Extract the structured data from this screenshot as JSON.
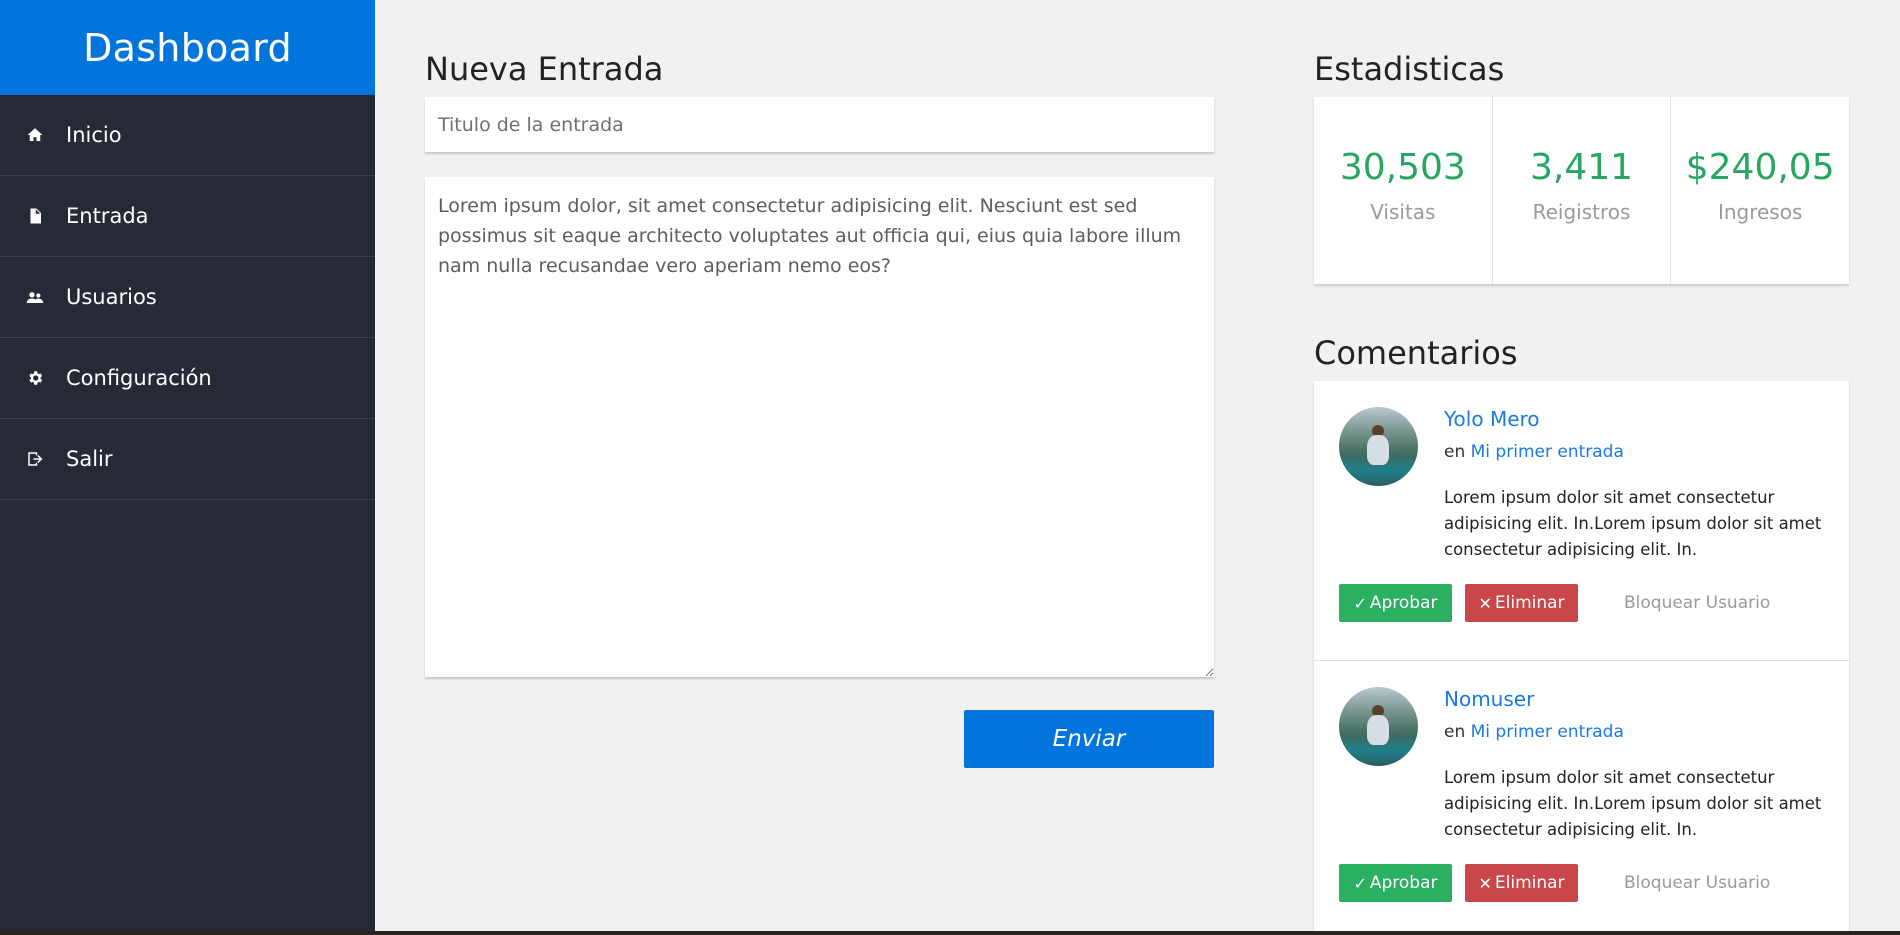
{
  "sidebar": {
    "brand": "Dashboard",
    "items": [
      {
        "label": "Inicio",
        "icon": "home-icon"
      },
      {
        "label": "Entrada",
        "icon": "document-icon"
      },
      {
        "label": "Usuarios",
        "icon": "users-icon"
      },
      {
        "label": "Configuración",
        "icon": "gear-icon"
      },
      {
        "label": "Salir",
        "icon": "logout-icon"
      }
    ]
  },
  "editor": {
    "title": "Nueva Entrada",
    "title_placeholder": "Titulo de la entrada",
    "content": "Lorem ipsum dolor, sit amet consectetur adipisicing elit. Nesciunt est sed possimus sit eaque architecto voluptates aut officia qui, eius quia labore illum nam nulla recusandae vero aperiam nemo eos?",
    "submit_label": "Enviar"
  },
  "stats": {
    "title": "Estadisticas",
    "items": [
      {
        "value": "30,503",
        "label": "Visitas"
      },
      {
        "value": "3,411",
        "label": "Reigistros"
      },
      {
        "value": "$240,05",
        "label": "Ingresos"
      }
    ]
  },
  "comments": {
    "title": "Comentarios",
    "items": [
      {
        "author": "Yolo Mero",
        "prefix": "en",
        "post": "Mi primer entrada",
        "text": "Lorem ipsum dolor sit amet consectetur adipisicing elit. In.Lorem ipsum dolor sit amet consectetur adipisicing elit. In.",
        "approve": "Aprobar",
        "delete": "Eliminar",
        "block": "Bloquear Usuario"
      },
      {
        "author": "Nomuser",
        "prefix": "en",
        "post": "Mi primer entrada",
        "text": "Lorem ipsum dolor sit amet consectetur adipisicing elit. In.Lorem ipsum dolor sit amet consectetur adipisicing elit. In.",
        "approve": "Aprobar",
        "delete": "Eliminar",
        "block": "Bloquear Usuario"
      }
    ]
  },
  "colors": {
    "accent": "#0275dc",
    "sidebar": "#252a36",
    "stat_value": "#27a660",
    "approve": "#2bb062",
    "delete": "#c9464a",
    "link": "#1a7be0"
  }
}
